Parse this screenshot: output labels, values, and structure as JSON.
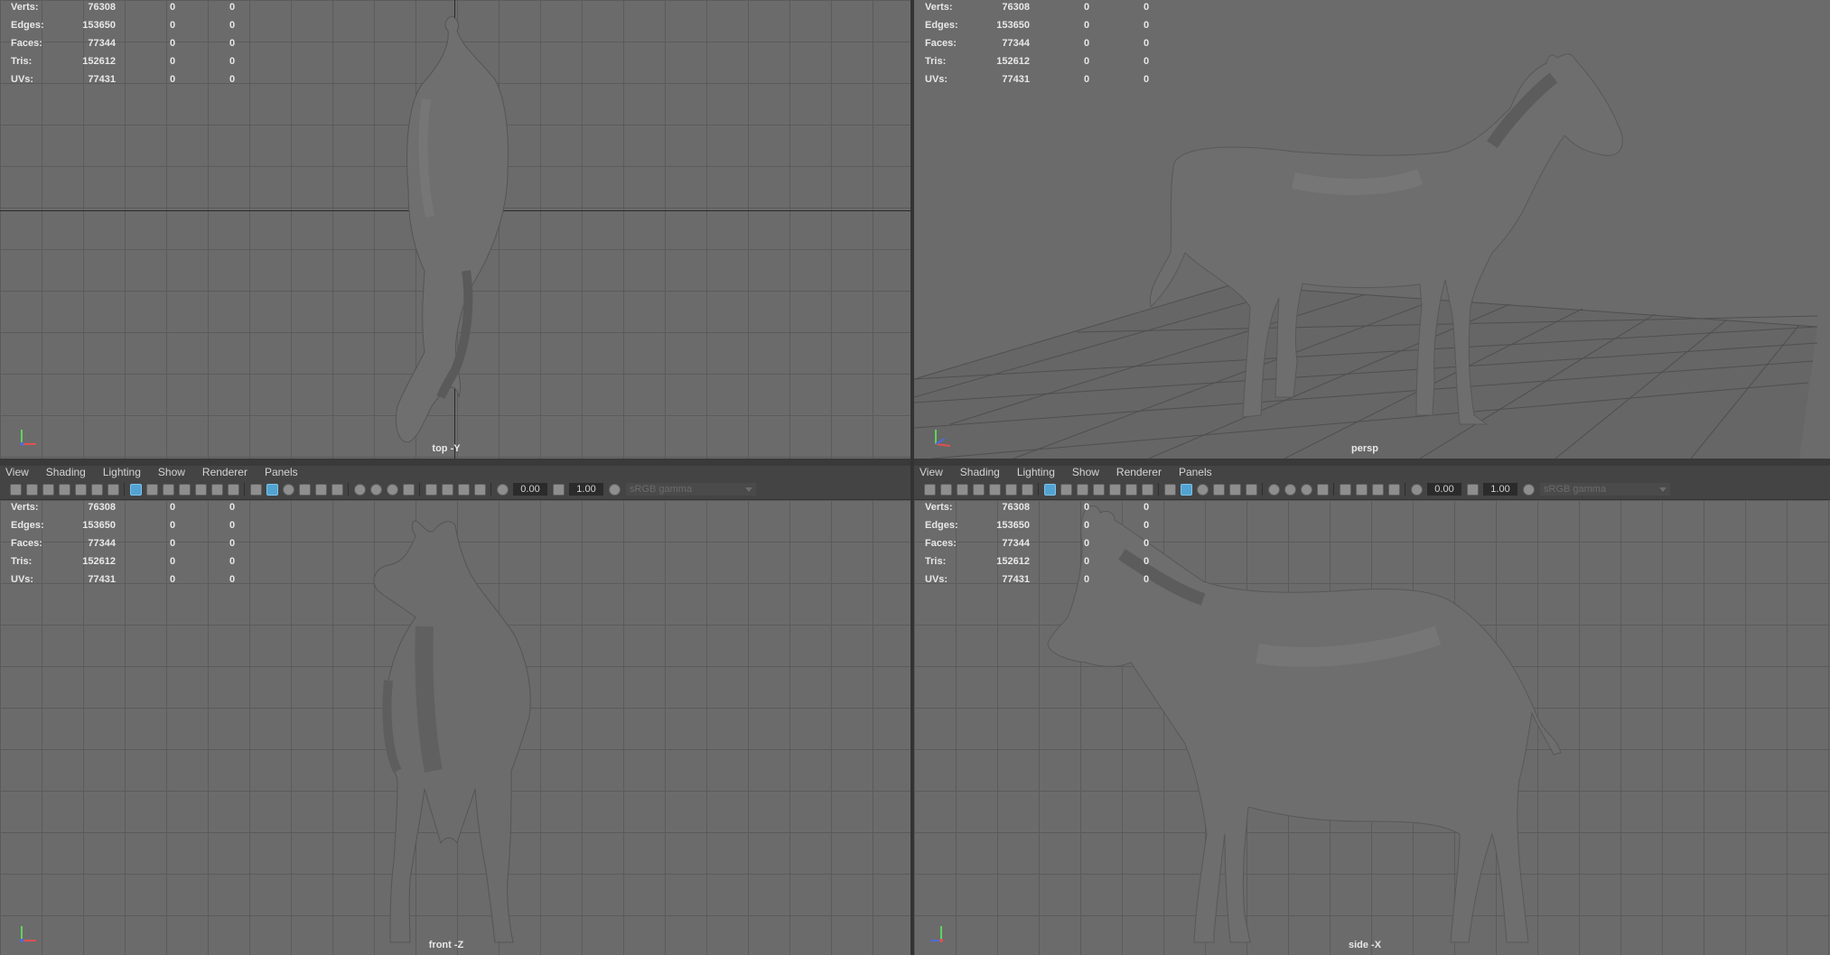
{
  "stats": {
    "rows": [
      {
        "label": "Verts:",
        "value": "76308",
        "a": "0",
        "b": "0"
      },
      {
        "label": "Edges:",
        "value": "153650",
        "a": "0",
        "b": "0"
      },
      {
        "label": "Faces:",
        "value": "77344",
        "a": "0",
        "b": "0"
      },
      {
        "label": "Tris:",
        "value": "152612",
        "a": "0",
        "b": "0"
      },
      {
        "label": "UVs:",
        "value": "77431",
        "a": "0",
        "b": "0"
      }
    ]
  },
  "viewports": {
    "top": {
      "camera": "top -Y"
    },
    "persp": {
      "camera": "persp"
    },
    "front": {
      "camera": "front -Z"
    },
    "side": {
      "camera": "side -X"
    }
  },
  "panel_menu": [
    "View",
    "Shading",
    "Lighting",
    "Show",
    "Renderer",
    "Panels"
  ],
  "toolbar": {
    "exposure": "0.00",
    "gamma": "1.00",
    "color_space": "sRGB gamma"
  },
  "colors": {
    "viewport_bg": "#6b6b6b",
    "grid": "#5b5b5b",
    "model": "#6e6e6e",
    "active_icon": "#52a3d1"
  }
}
